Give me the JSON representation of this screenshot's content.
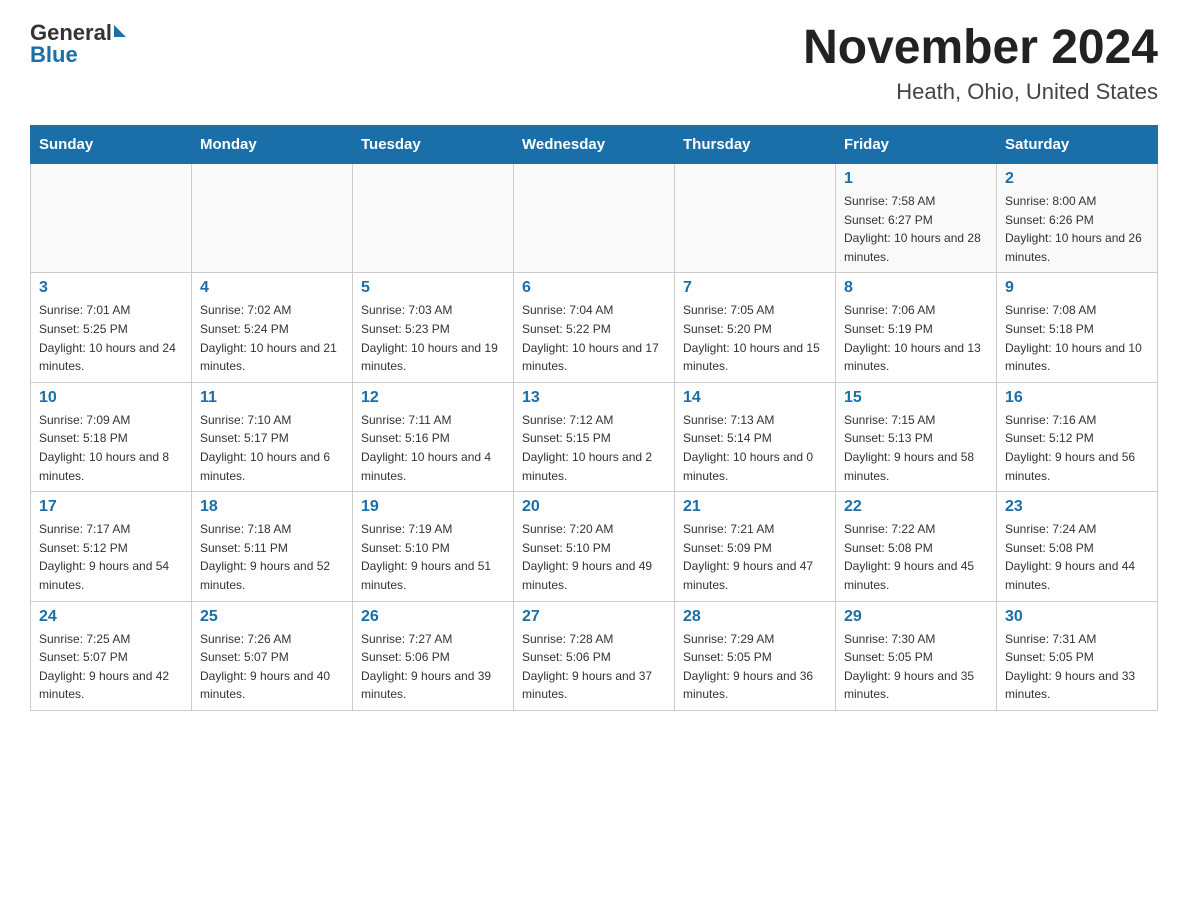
{
  "header": {
    "logo_general": "General",
    "logo_blue": "Blue",
    "month_title": "November 2024",
    "location": "Heath, Ohio, United States"
  },
  "days_of_week": [
    "Sunday",
    "Monday",
    "Tuesday",
    "Wednesday",
    "Thursday",
    "Friday",
    "Saturday"
  ],
  "weeks": [
    [
      {
        "day": "",
        "info": ""
      },
      {
        "day": "",
        "info": ""
      },
      {
        "day": "",
        "info": ""
      },
      {
        "day": "",
        "info": ""
      },
      {
        "day": "",
        "info": ""
      },
      {
        "day": "1",
        "info": "Sunrise: 7:58 AM\nSunset: 6:27 PM\nDaylight: 10 hours and 28 minutes."
      },
      {
        "day": "2",
        "info": "Sunrise: 8:00 AM\nSunset: 6:26 PM\nDaylight: 10 hours and 26 minutes."
      }
    ],
    [
      {
        "day": "3",
        "info": "Sunrise: 7:01 AM\nSunset: 5:25 PM\nDaylight: 10 hours and 24 minutes."
      },
      {
        "day": "4",
        "info": "Sunrise: 7:02 AM\nSunset: 5:24 PM\nDaylight: 10 hours and 21 minutes."
      },
      {
        "day": "5",
        "info": "Sunrise: 7:03 AM\nSunset: 5:23 PM\nDaylight: 10 hours and 19 minutes."
      },
      {
        "day": "6",
        "info": "Sunrise: 7:04 AM\nSunset: 5:22 PM\nDaylight: 10 hours and 17 minutes."
      },
      {
        "day": "7",
        "info": "Sunrise: 7:05 AM\nSunset: 5:20 PM\nDaylight: 10 hours and 15 minutes."
      },
      {
        "day": "8",
        "info": "Sunrise: 7:06 AM\nSunset: 5:19 PM\nDaylight: 10 hours and 13 minutes."
      },
      {
        "day": "9",
        "info": "Sunrise: 7:08 AM\nSunset: 5:18 PM\nDaylight: 10 hours and 10 minutes."
      }
    ],
    [
      {
        "day": "10",
        "info": "Sunrise: 7:09 AM\nSunset: 5:18 PM\nDaylight: 10 hours and 8 minutes."
      },
      {
        "day": "11",
        "info": "Sunrise: 7:10 AM\nSunset: 5:17 PM\nDaylight: 10 hours and 6 minutes."
      },
      {
        "day": "12",
        "info": "Sunrise: 7:11 AM\nSunset: 5:16 PM\nDaylight: 10 hours and 4 minutes."
      },
      {
        "day": "13",
        "info": "Sunrise: 7:12 AM\nSunset: 5:15 PM\nDaylight: 10 hours and 2 minutes."
      },
      {
        "day": "14",
        "info": "Sunrise: 7:13 AM\nSunset: 5:14 PM\nDaylight: 10 hours and 0 minutes."
      },
      {
        "day": "15",
        "info": "Sunrise: 7:15 AM\nSunset: 5:13 PM\nDaylight: 9 hours and 58 minutes."
      },
      {
        "day": "16",
        "info": "Sunrise: 7:16 AM\nSunset: 5:12 PM\nDaylight: 9 hours and 56 minutes."
      }
    ],
    [
      {
        "day": "17",
        "info": "Sunrise: 7:17 AM\nSunset: 5:12 PM\nDaylight: 9 hours and 54 minutes."
      },
      {
        "day": "18",
        "info": "Sunrise: 7:18 AM\nSunset: 5:11 PM\nDaylight: 9 hours and 52 minutes."
      },
      {
        "day": "19",
        "info": "Sunrise: 7:19 AM\nSunset: 5:10 PM\nDaylight: 9 hours and 51 minutes."
      },
      {
        "day": "20",
        "info": "Sunrise: 7:20 AM\nSunset: 5:10 PM\nDaylight: 9 hours and 49 minutes."
      },
      {
        "day": "21",
        "info": "Sunrise: 7:21 AM\nSunset: 5:09 PM\nDaylight: 9 hours and 47 minutes."
      },
      {
        "day": "22",
        "info": "Sunrise: 7:22 AM\nSunset: 5:08 PM\nDaylight: 9 hours and 45 minutes."
      },
      {
        "day": "23",
        "info": "Sunrise: 7:24 AM\nSunset: 5:08 PM\nDaylight: 9 hours and 44 minutes."
      }
    ],
    [
      {
        "day": "24",
        "info": "Sunrise: 7:25 AM\nSunset: 5:07 PM\nDaylight: 9 hours and 42 minutes."
      },
      {
        "day": "25",
        "info": "Sunrise: 7:26 AM\nSunset: 5:07 PM\nDaylight: 9 hours and 40 minutes."
      },
      {
        "day": "26",
        "info": "Sunrise: 7:27 AM\nSunset: 5:06 PM\nDaylight: 9 hours and 39 minutes."
      },
      {
        "day": "27",
        "info": "Sunrise: 7:28 AM\nSunset: 5:06 PM\nDaylight: 9 hours and 37 minutes."
      },
      {
        "day": "28",
        "info": "Sunrise: 7:29 AM\nSunset: 5:05 PM\nDaylight: 9 hours and 36 minutes."
      },
      {
        "day": "29",
        "info": "Sunrise: 7:30 AM\nSunset: 5:05 PM\nDaylight: 9 hours and 35 minutes."
      },
      {
        "day": "30",
        "info": "Sunrise: 7:31 AM\nSunset: 5:05 PM\nDaylight: 9 hours and 33 minutes."
      }
    ]
  ]
}
